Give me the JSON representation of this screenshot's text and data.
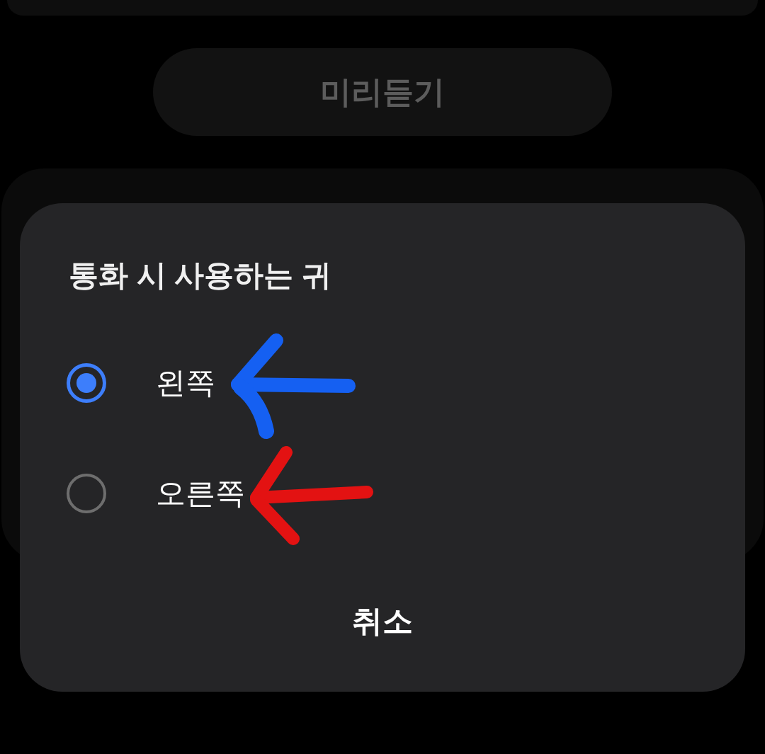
{
  "preview_button": {
    "label": "미리듣기",
    "disabled": true
  },
  "dialog": {
    "title": "통화 시 사용하는 귀",
    "options": [
      {
        "label": "왼쪽",
        "selected": true
      },
      {
        "label": "오른쪽",
        "selected": false
      }
    ],
    "cancel_button": "취소"
  }
}
